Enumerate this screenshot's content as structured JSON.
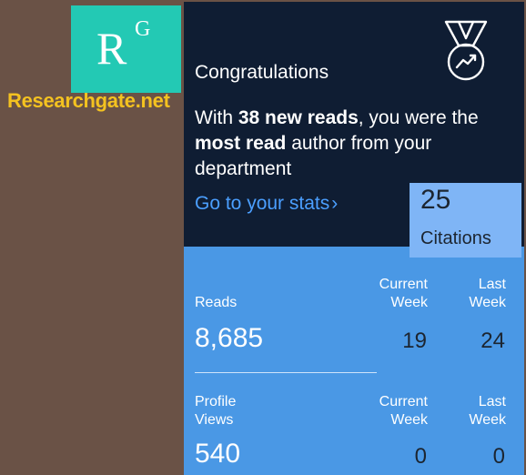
{
  "brand": {
    "logo_letter": "R",
    "logo_sup": "G",
    "site_label": "Researchgate.net"
  },
  "notification": {
    "title": "Congratulations",
    "msg_prefix": "With ",
    "msg_bold1": "38 new reads",
    "msg_mid": ", you were the ",
    "msg_bold2": "most read",
    "msg_suffix": " author from your department",
    "link_label": "Go to your stats",
    "link_arrow": "›",
    "badge_icon": "medal-trending-up-icon"
  },
  "citations": {
    "value": "25",
    "label": "Citations"
  },
  "stats": {
    "reads": {
      "label": "Reads",
      "total": "8,685",
      "current_week_label": "Current Week",
      "last_week_label": "Last Week",
      "current_week": "19",
      "last_week": "24"
    },
    "profile_views": {
      "label": "Profile Views",
      "total": "540",
      "current_week_label": "Current Week",
      "last_week_label": "Last Week",
      "current_week": "0",
      "last_week": "0"
    }
  },
  "colors": {
    "background": "#6a5246",
    "logo": "#23c9b4",
    "site_label": "#f4c220",
    "card_dark": "#0f1d33",
    "card_blue": "#4a98e5",
    "link": "#4b9fff",
    "citations_box": "#7fb5f6"
  }
}
